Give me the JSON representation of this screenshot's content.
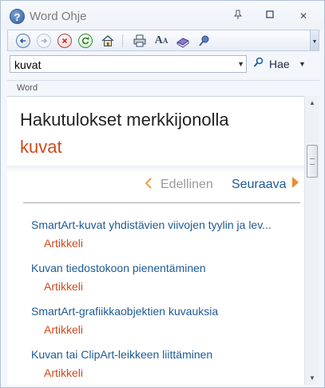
{
  "window": {
    "title": "Word Ohje",
    "app_icon_glyph": "?",
    "minimize_label": "─",
    "restore_label": "❐",
    "close_label": "✕"
  },
  "toolbar": {
    "back_icon": "back-arrow-icon",
    "forward_icon": "forward-arrow-icon",
    "stop_icon": "stop-icon",
    "refresh_icon": "refresh-icon",
    "home_icon": "home-icon",
    "print_icon": "printer-icon",
    "font_size_icon": "font-size-icon",
    "toc_icon": "book-icon",
    "pin_icon": "pin-icon",
    "overflow_icon": "chevron-down-icon"
  },
  "search": {
    "value": "kuvat",
    "button_label": "Hae"
  },
  "breadcrumb": {
    "label": "Word"
  },
  "results": {
    "heading": "Hakutulokset merkkijonolla",
    "query": "kuvat",
    "prev_label": "Edellinen",
    "next_label": "Seuraava",
    "items": [
      {
        "title": "SmartArt-kuvat yhdistävien viivojen tyylin ja lev...",
        "type": "Artikkeli"
      },
      {
        "title": "Kuvan tiedostokoon pienentäminen",
        "type": "Artikkeli"
      },
      {
        "title": "SmartArt-grafiikkaobjektien kuvauksia",
        "type": "Artikkeli"
      },
      {
        "title": "Kuvan tai ClipArt-leikkeen liittäminen",
        "type": "Artikkeli"
      }
    ]
  },
  "colors": {
    "link": "#1c5a96",
    "accent_orange": "#d04a1c",
    "arrow_orange": "#e98e2a"
  }
}
